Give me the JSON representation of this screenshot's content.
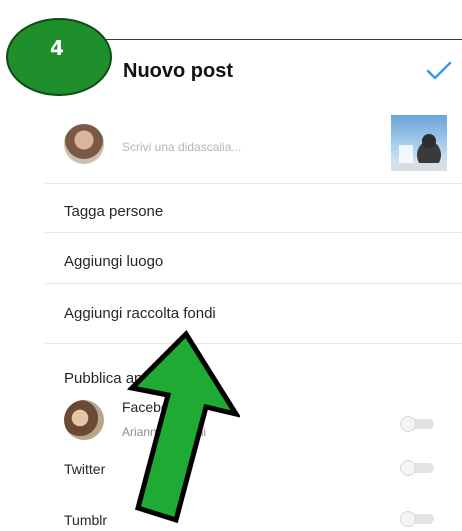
{
  "step": {
    "number": "4",
    "color": "#1f8f2c"
  },
  "header": {
    "title": "Nuovo post",
    "confirm_icon": "checkmark-icon",
    "accent": "#3897f0"
  },
  "caption": {
    "placeholder": "Scrivi una didascalia..."
  },
  "options": [
    {
      "label": "Tagga persone"
    },
    {
      "label": "Aggiungi luogo"
    },
    {
      "label": "Aggiungi raccolta fondi"
    }
  ],
  "share": {
    "section_label": "Pubblica anche su",
    "facebook": {
      "name": "Facebook",
      "account": "Arianna Bianchi",
      "enabled": false
    },
    "twitter": {
      "label": "Twitter",
      "enabled": false
    },
    "tumblr": {
      "label": "Tumblr",
      "enabled": false
    }
  }
}
